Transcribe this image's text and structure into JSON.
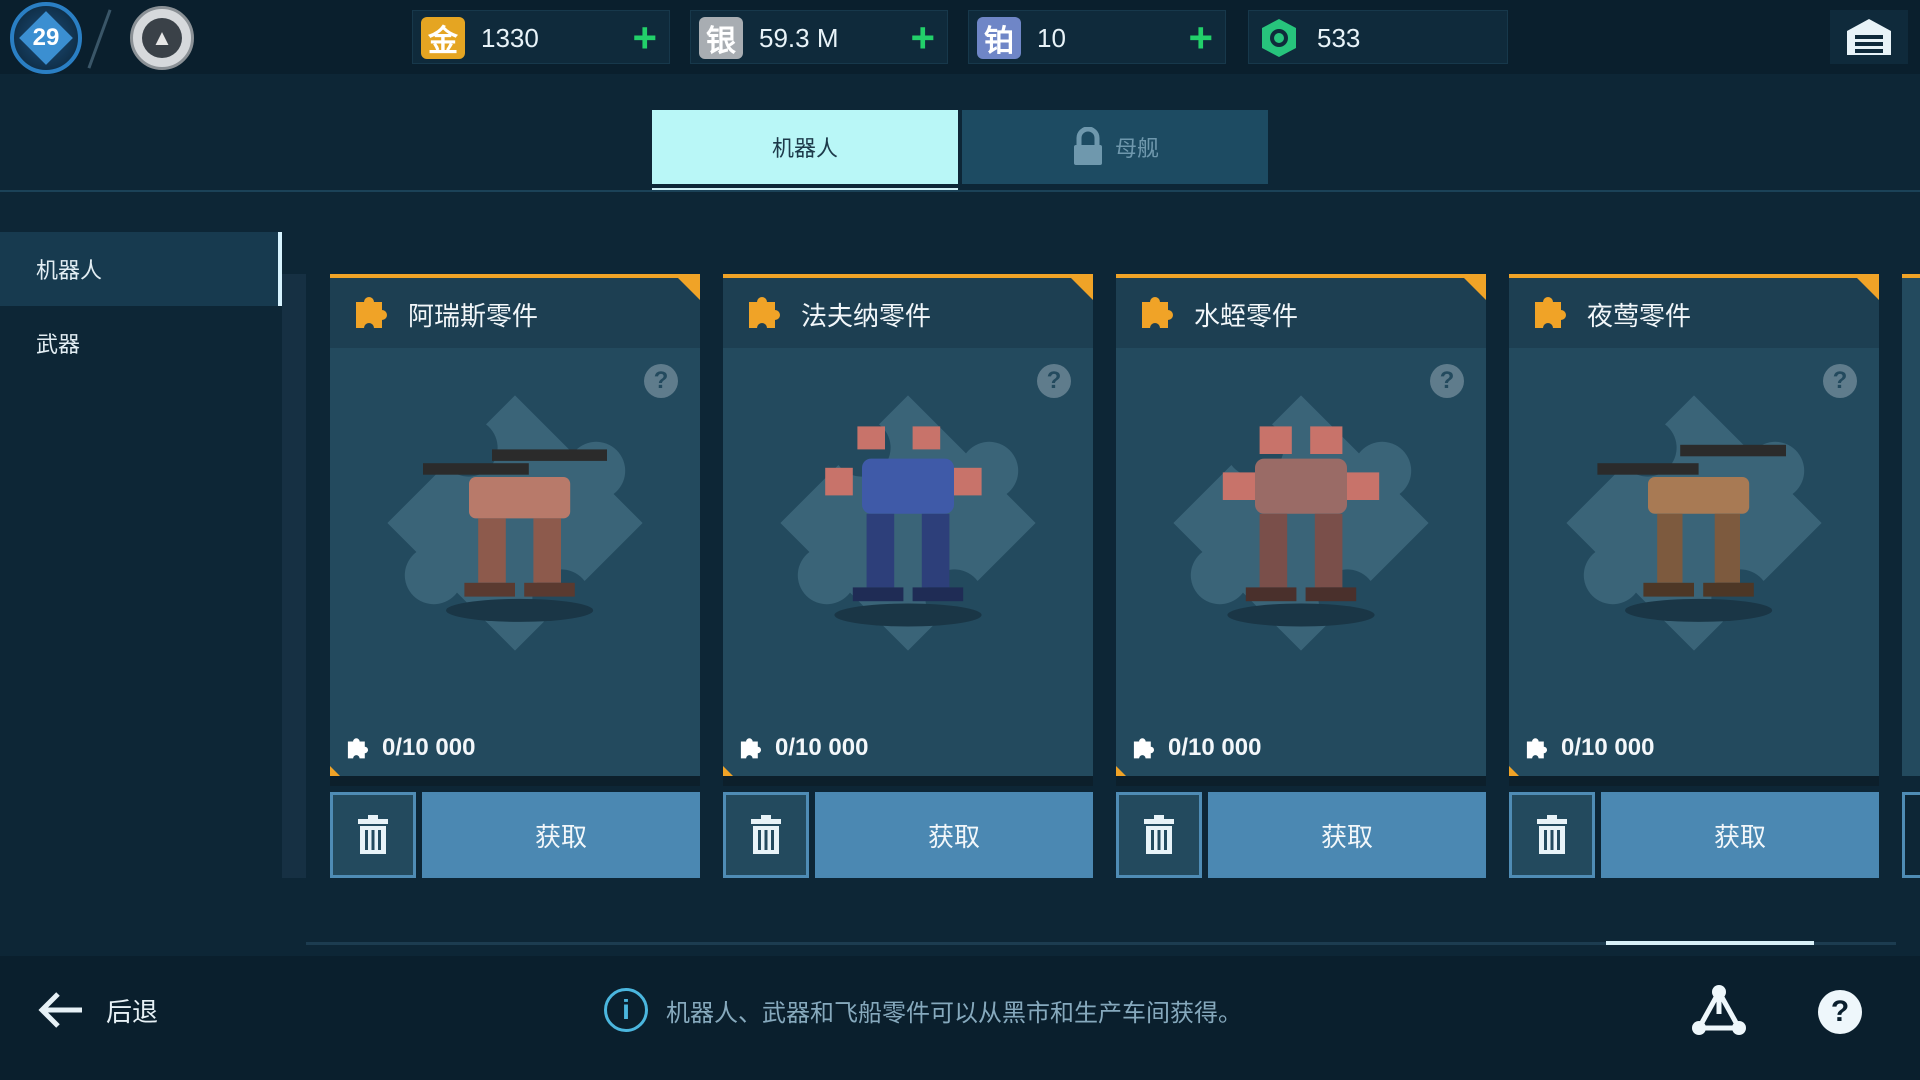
{
  "topbar": {
    "level": "29",
    "currencies": [
      {
        "name": "gold",
        "glyph": "金",
        "value": "1330",
        "color": "#e5a522",
        "has_plus": true
      },
      {
        "name": "silver",
        "glyph": "银",
        "value": "59.3 M",
        "color": "#a8adb2",
        "has_plus": true
      },
      {
        "name": "platinum",
        "glyph": "铂",
        "value": "10",
        "color": "#6f86c7",
        "has_plus": true
      },
      {
        "name": "key",
        "glyph": "",
        "value": "533",
        "color": "#27c47c",
        "has_plus": false
      }
    ]
  },
  "tabs": {
    "robots": "机器人",
    "mothership": "母舰"
  },
  "sidebar": {
    "items": [
      {
        "label": "机器人",
        "active": true
      },
      {
        "label": "武器",
        "active": false
      }
    ]
  },
  "cards": [
    {
      "name": "阿瑞斯零件",
      "count": "0/10 000",
      "action": "获取",
      "robot_color": "#b87a6a"
    },
    {
      "name": "法夫纳零件",
      "count": "0/10 000",
      "action": "获取",
      "robot_color": "#3f5aa8"
    },
    {
      "name": "水蛭零件",
      "count": "0/10 000",
      "action": "获取",
      "robot_color": "#c8736a"
    },
    {
      "name": "夜莺零件",
      "count": "0/10 000",
      "action": "获取",
      "robot_color": "#a87a54"
    }
  ],
  "bottom": {
    "back_label": "后退",
    "info_text": "机器人、武器和飞船零件可以从黑市和生产车间获得。"
  },
  "colors": {
    "accent_orange": "#f0a327",
    "accent_cyan": "#b9f7f7",
    "button_blue": "#4b88b2",
    "plus_green": "#22d06a"
  }
}
